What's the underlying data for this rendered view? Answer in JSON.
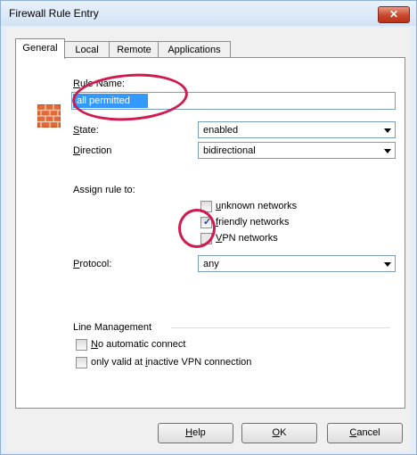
{
  "window": {
    "title": "Firewall Rule Entry",
    "close": "✕"
  },
  "tabs": [
    {
      "label": "General"
    },
    {
      "label": "Local"
    },
    {
      "label": "Remote"
    },
    {
      "label": "Applications"
    }
  ],
  "rule_name": {
    "label_key": "R",
    "label_rest": "ule Name:",
    "value": "all permitted"
  },
  "state": {
    "label_key": "S",
    "label_rest": "tate:",
    "value": "enabled"
  },
  "direction": {
    "label_key": "D",
    "label_rest": "irection",
    "value": "bidirectional"
  },
  "assign": {
    "label": "Assign rule to:",
    "options": [
      {
        "key": "u",
        "rest": "nknown networks",
        "checked": false
      },
      {
        "key": "f",
        "rest": "riendly networks",
        "checked": true
      },
      {
        "key": "V",
        "rest": "PN networks",
        "checked": false
      }
    ]
  },
  "protocol": {
    "label_key": "P",
    "label_rest": "rotocol:",
    "value": "any"
  },
  "line_management": {
    "label": "Line Management",
    "no_auto": {
      "key": "N",
      "rest": "o automatic connect",
      "checked": false
    },
    "only_valid": {
      "pre": "only valid at ",
      "key": "i",
      "rest": "nactive VPN connection",
      "checked": false
    }
  },
  "buttons": {
    "help": {
      "key": "H",
      "rest": "elp"
    },
    "ok": {
      "key": "O",
      "rest": "K"
    },
    "cancel": {
      "key": "C",
      "rest": "ancel"
    }
  },
  "icons": {
    "rule": "firewall-brick-icon",
    "dropdown": "chevron-down-icon"
  },
  "colors": {
    "annotation": "#d11a4e",
    "selection": "#3399ff",
    "title_bar": "#dbe8f7"
  }
}
